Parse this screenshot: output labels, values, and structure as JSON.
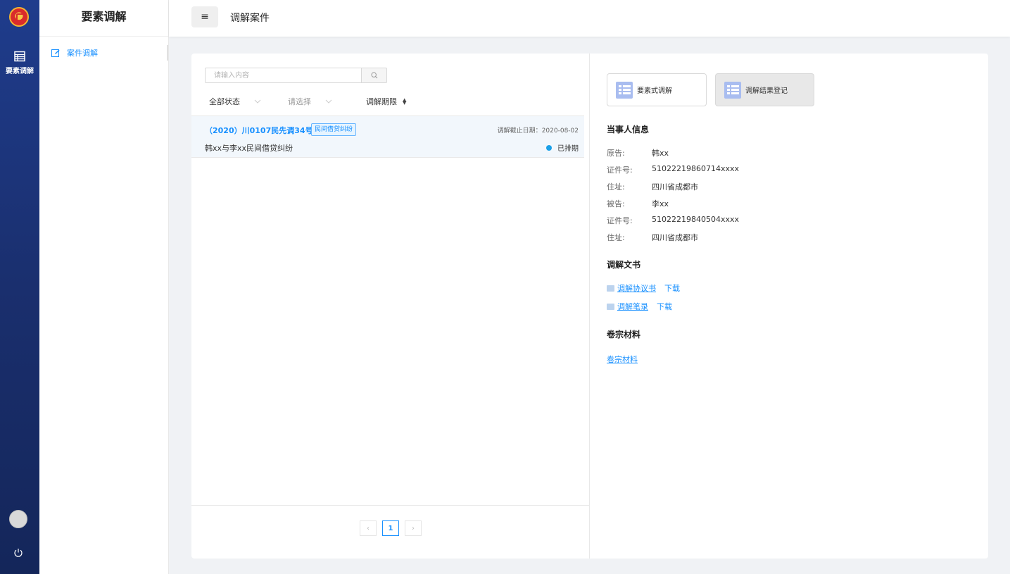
{
  "rail": {
    "nav_label": "要素调解"
  },
  "sidebar": {
    "title": "要素调解",
    "menu_item": "案件调解"
  },
  "header": {
    "title": "调解案件"
  },
  "list": {
    "search_placeholder": "请输入内容",
    "filters": {
      "status": "全部状态",
      "select_placeholder": "请选择",
      "sort_label": "调解期限"
    },
    "cases": [
      {
        "case_no": "（2020）川0107民先调34号",
        "tag": "民间借贷纠纷",
        "deadline_label": "调解截止日期：",
        "deadline": "2020-08-02",
        "title": "韩xx与李xx民间借贷纠纷",
        "status": "已排期"
      }
    ],
    "pagination": {
      "current": "1"
    }
  },
  "detail": {
    "buttons": {
      "element_mediation": "要素式调解",
      "result_register": "调解结果登记"
    },
    "party_section_title": "当事人信息",
    "parties": [
      {
        "key": "原告:",
        "value": "韩xx"
      },
      {
        "key": "证件号:",
        "value": "51022219860714xxxx"
      },
      {
        "key": "住址:",
        "value": "四川省成都市"
      },
      {
        "key": "被告:",
        "value": "李xx"
      },
      {
        "key": "证件号:",
        "value": "51022219840504xxxx"
      },
      {
        "key": "住址:",
        "value": "四川省成都市"
      }
    ],
    "docs_section_title": "调解文书",
    "docs": [
      {
        "name": "调解协议书",
        "download": "下载"
      },
      {
        "name": "调解笔录",
        "download": "下载"
      }
    ],
    "materials_section_title": "卷宗材料",
    "materials_link": "卷宗材料"
  },
  "colors": {
    "accent": "#1890ff",
    "rail_bg": "#1f3c8c",
    "status_dot": "#1aa0e8"
  }
}
